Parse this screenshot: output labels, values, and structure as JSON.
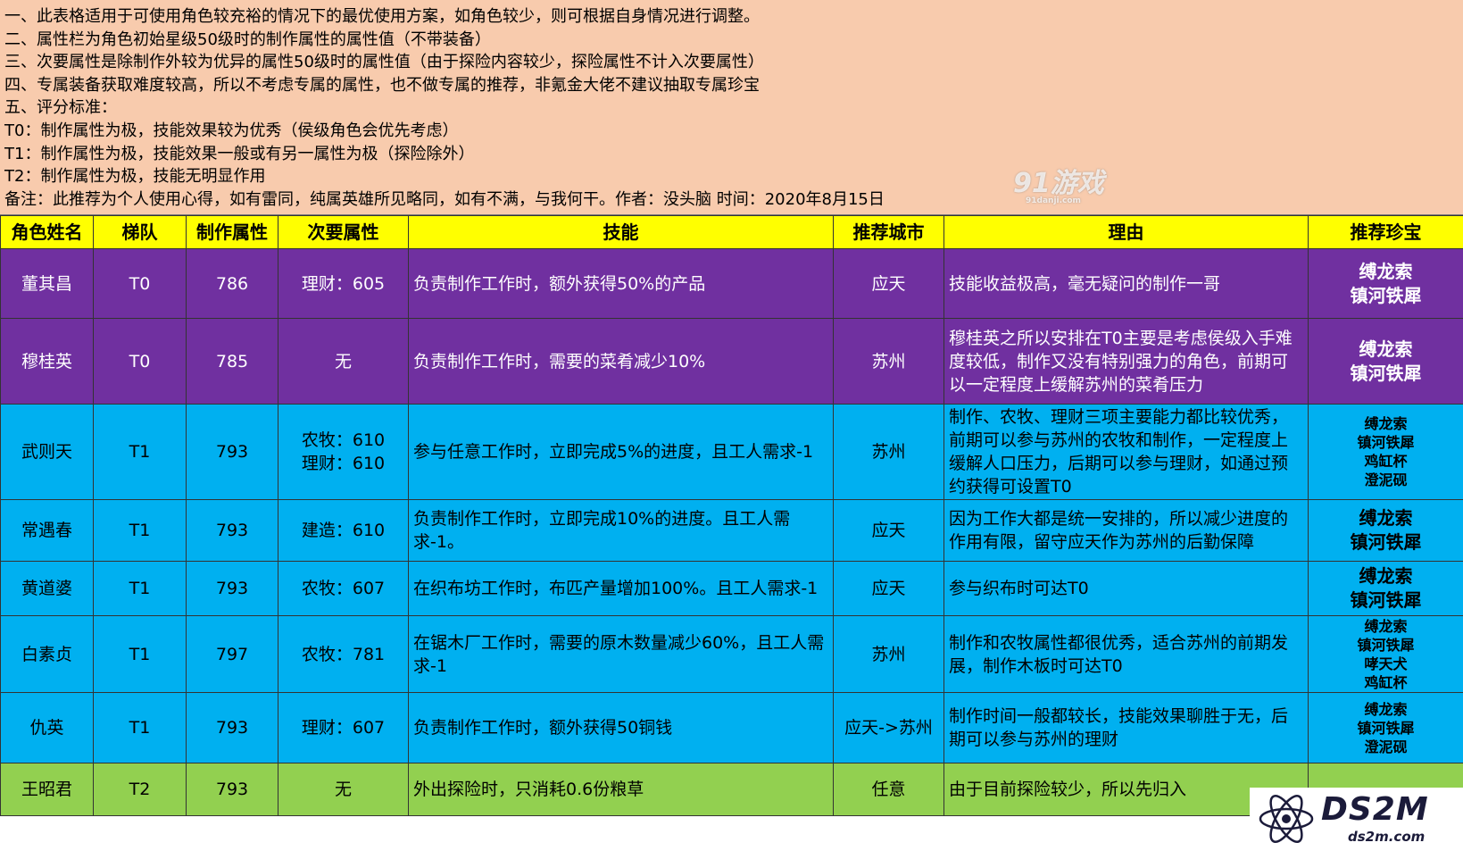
{
  "notes": [
    "一、此表格适用于可使用角色较充裕的情况下的最优使用方案，如角色较少，则可根据自身情况进行调整。",
    "二、属性栏为角色初始星级50级时的制作属性的属性值（不带装备）",
    "三、次要属性是除制作外较为优异的属性50级时的属性值（由于探险内容较少，探险属性不计入次要属性）",
    "四、专属装备获取难度较高，所以不考虑专属的属性，也不做专属的推荐，非氪金大佬不建议抽取专属珍宝",
    "五、评分标准：",
    "T0：制作属性为极，技能效果较为优秀（侯级角色会优先考虑）",
    "T1：制作属性为极，技能效果一般或有另一属性为极（探险除外）",
    "T2：制作属性为极，技能无明显作用",
    "备注：此推荐为个人使用心得，如有雷同，纯属英雄所见略同，如有不满，与我何干。作者：没头脑 时间：2020年8月15日"
  ],
  "watermark_91": {
    "main": "91游戏",
    "sub": "91danji.com"
  },
  "headers": [
    "角色姓名",
    "梯队",
    "制作属性",
    "次要属性",
    "技能",
    "推荐城市",
    "理由",
    "推荐珍宝"
  ],
  "rows": [
    {
      "name": "董其昌",
      "tier": "T0",
      "craft": "786",
      "secondary": [
        "理财：605"
      ],
      "skill": "负责制作工作时，额外获得50%的产品",
      "city": "应天",
      "reason": "技能收益极高，毫无疑问的制作一哥",
      "treasure": [
        "缚龙索",
        "镇河铁犀"
      ],
      "color": "purple"
    },
    {
      "name": "穆桂英",
      "tier": "T0",
      "craft": "785",
      "secondary": [
        "无"
      ],
      "skill": "负责制作工作时，需要的菜肴减少10%",
      "city": "苏州",
      "reason": "穆桂英之所以安排在T0主要是考虑侯级入手难度较低，制作又没有特别强力的角色，前期可以一定程度上缓解苏州的菜肴压力",
      "treasure": [
        "缚龙索",
        "镇河铁犀"
      ],
      "color": "purple"
    },
    {
      "name": "武则天",
      "tier": "T1",
      "craft": "793",
      "secondary": [
        "农牧：610",
        "理财：610"
      ],
      "skill": "参与任意工作时，立即完成5%的进度，且工人需求-1",
      "city": "苏州",
      "reason": "制作、农牧、理财三项主要能力都比较优秀，前期可以参与苏州的农牧和制作，一定程度上缓解人口压力，后期可以参与理财，如通过预约获得可设置T0",
      "treasure": [
        "缚龙索",
        "镇河铁犀",
        "鸡缸杯",
        "澄泥砚"
      ],
      "color": "blue"
    },
    {
      "name": "常遇春",
      "tier": "T1",
      "craft": "793",
      "secondary": [
        "建造：610"
      ],
      "skill": "负责制作工作时，立即完成10%的进度。且工人需求-1。",
      "city": "应天",
      "reason": "因为工作大都是统一安排的，所以减少进度的作用有限，留守应天作为苏州的后勤保障",
      "treasure": [
        "缚龙索",
        "镇河铁犀"
      ],
      "color": "blue"
    },
    {
      "name": "黄道婆",
      "tier": "T1",
      "craft": "793",
      "secondary": [
        "农牧：607"
      ],
      "skill": "在织布坊工作时，布匹产量增加100%。且工人需求-1",
      "city": "应天",
      "reason": "参与织布时可达T0",
      "treasure": [
        "缚龙索",
        "镇河铁犀"
      ],
      "color": "blue"
    },
    {
      "name": "白素贞",
      "tier": "T1",
      "craft": "797",
      "secondary": [
        "农牧：781"
      ],
      "skill": "在锯木厂工作时，需要的原木数量减少60%，且工人需求-1",
      "city": "苏州",
      "reason": "制作和农牧属性都很优秀，适合苏州的前期发展，制作木板时可达T0",
      "treasure": [
        "缚龙索",
        "镇河铁犀",
        "哮天犬",
        "鸡缸杯"
      ],
      "color": "blue"
    },
    {
      "name": "仇英",
      "tier": "T1",
      "craft": "793",
      "secondary": [
        "理财：607"
      ],
      "skill": "负责制作工作时，额外获得50铜钱",
      "city": "应天->苏州",
      "reason": "制作时间一般都较长，技能效果聊胜于无，后期可以参与苏州的理财",
      "treasure": [
        "缚龙索",
        "镇河铁犀",
        "澄泥砚"
      ],
      "color": "blue"
    },
    {
      "name": "王昭君",
      "tier": "T2",
      "craft": "793",
      "secondary": [
        "无"
      ],
      "skill": "外出探险时，只消耗0.6份粮草",
      "city": "任意",
      "reason": "由于目前探险较少，所以先归入",
      "treasure": [
        ""
      ],
      "color": "green"
    }
  ],
  "ds2m": {
    "title": "DS2M",
    "sub": "ds2m.com"
  }
}
